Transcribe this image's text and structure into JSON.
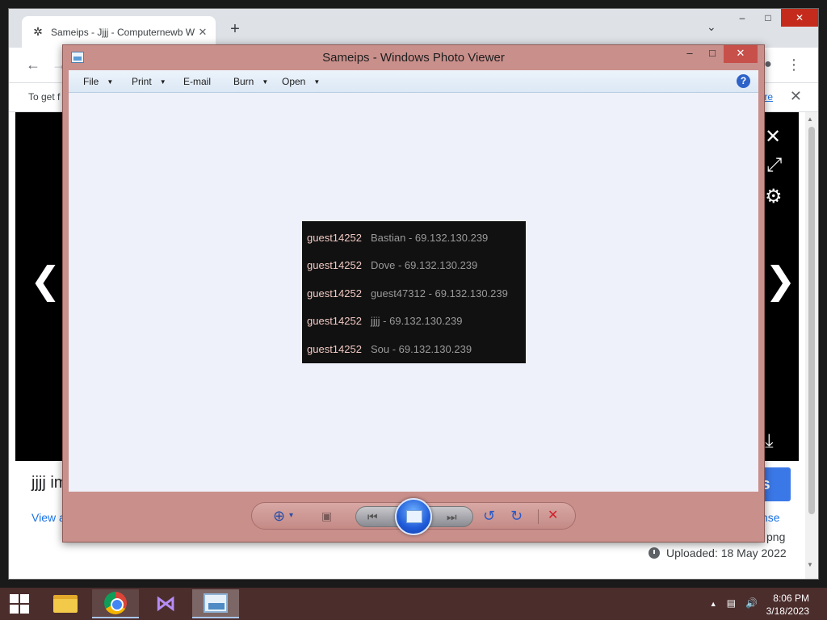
{
  "browser": {
    "tab": {
      "title": "Sameips - Jjjj - Computernewb W",
      "close": "✕",
      "favicon": "bug-icon"
    },
    "new_tab": "+",
    "tab_search": "⌄",
    "window_controls": {
      "minimize": "–",
      "maximize": "□",
      "close": "✕"
    },
    "nav": {
      "back": "←",
      "forward": "→",
      "account": "person-icon",
      "menu": "⋮"
    },
    "infobar": {
      "text": "To get f",
      "link": "re",
      "close": "✕"
    }
  },
  "page": {
    "title": "jjjj im",
    "view_all": "View a",
    "download_label": "ls",
    "license": "nse",
    "filetype": "png",
    "uploaded": "Uploaded: 18 May 2022",
    "viewer_icons": {
      "close": "✕",
      "expand": "⤢",
      "settings": "⚙",
      "download": "⤓"
    },
    "arrows": {
      "left": "❮",
      "right": "❯"
    }
  },
  "photo_viewer": {
    "title": "Sameips - Windows Photo Viewer",
    "controls": {
      "minimize": "–",
      "maximize": "□",
      "close": "✕"
    },
    "menu": [
      {
        "label": "File",
        "dropdown": true
      },
      {
        "label": "Print",
        "dropdown": true
      },
      {
        "label": "E-mail",
        "dropdown": false
      },
      {
        "label": "Burn",
        "dropdown": true
      },
      {
        "label": "Open",
        "dropdown": true
      }
    ],
    "help": "?",
    "image_rows": [
      {
        "user": "guest14252",
        "entry": "Bastian - 69.132.130.239"
      },
      {
        "user": "guest14252",
        "entry": "Dove - 69.132.130.239"
      },
      {
        "user": "guest14252",
        "entry": "guest47312 - 69.132.130.239"
      },
      {
        "user": "guest14252",
        "entry": "jjjj - 69.132.130.239"
      },
      {
        "user": "guest14252",
        "entry": "Sou - 69.132.130.239"
      }
    ],
    "bottom_controls": {
      "zoom": "⊕",
      "zoom_arrow": "▾",
      "fit": "▣",
      "prev": "⏮",
      "next": "⏭",
      "rotate_ccw": "↺",
      "rotate_cw": "↻",
      "delete": "✕"
    }
  },
  "taskbar": {
    "tray": {
      "arrow": "▲",
      "network": "▤",
      "volume": "🔊"
    },
    "time": "8:06 PM",
    "date": "3/18/2023"
  },
  "colors": {
    "photo_viewer_frame": "#c98f8b",
    "taskbar": "#4b2d2c",
    "image_username": "#f1c9c3",
    "link_blue": "#1a73e8"
  }
}
